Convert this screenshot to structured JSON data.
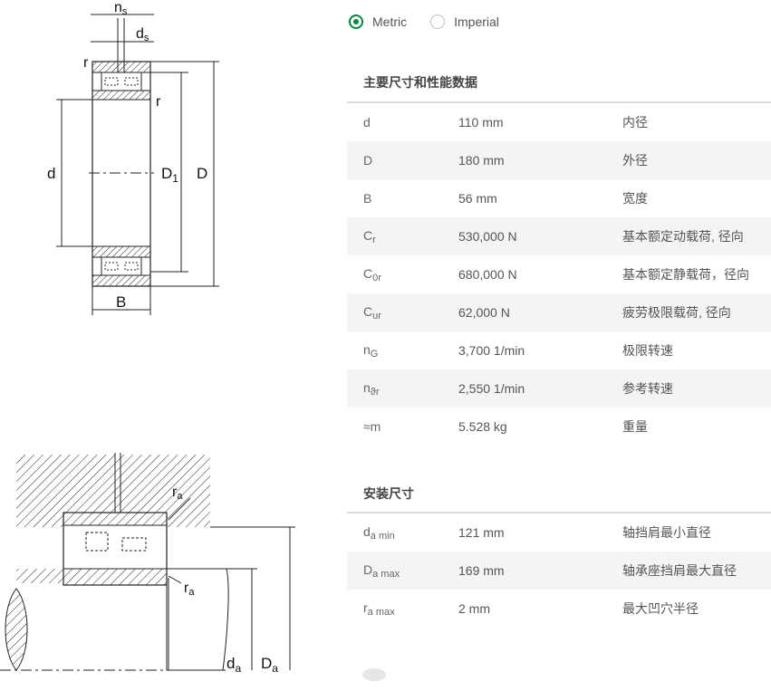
{
  "units": {
    "metric": "Metric",
    "imperial": "Imperial",
    "selected": "Metric"
  },
  "diagram_top_labels": {
    "ns": "n",
    "ns_sub": "s",
    "ds": "d",
    "ds_sub": "s",
    "r1": "r",
    "r2": "r",
    "d": "d",
    "D1": "D",
    "D1_sub": "1",
    "D": "D",
    "B": "B"
  },
  "diagram_bottom_labels": {
    "ra_top": "r",
    "ra_top_sub": "a",
    "ra_bottom": "r",
    "ra_bottom_sub": "a",
    "da": "d",
    "da_sub": "a",
    "Da": "D",
    "Da_sub": "a"
  },
  "dimensions": {
    "title": "主要尺寸和性能数据",
    "rows": [
      {
        "sym": "d",
        "sub": "",
        "val": "110 mm",
        "desc": "内径"
      },
      {
        "sym": "D",
        "sub": "",
        "val": "180 mm",
        "desc": "外径"
      },
      {
        "sym": "B",
        "sub": "",
        "val": "56 mm",
        "desc": "宽度"
      },
      {
        "sym": "C",
        "sub": "r",
        "val": "530,000 N",
        "desc": "基本额定动载荷, 径向"
      },
      {
        "sym": "C",
        "sub": "0r",
        "val": "680,000 N",
        "desc": "基本额定静载荷，径向"
      },
      {
        "sym": "C",
        "sub": "ur",
        "val": "62,000 N",
        "desc": "疲劳极限载荷, 径向"
      },
      {
        "sym": "n",
        "sub": "G",
        "val": "3,700 1/min",
        "desc": "极限转速"
      },
      {
        "sym": "n",
        "sub": "ϑr",
        "val": "2,550 1/min",
        "desc": "参考转速"
      },
      {
        "sym": "≈m",
        "sub": "",
        "val": "5.528 kg",
        "desc": "重量"
      }
    ]
  },
  "mounting": {
    "title": "安装尺寸",
    "rows": [
      {
        "sym": "d",
        "sub": "a min",
        "val": "121 mm",
        "desc": "轴挡肩最小直径"
      },
      {
        "sym": "D",
        "sub": "a max",
        "val": "169 mm",
        "desc": "轴承座挡肩最大直径"
      },
      {
        "sym": "r",
        "sub": "a max",
        "val": "2 mm",
        "desc": "最大凹穴半径"
      }
    ]
  }
}
